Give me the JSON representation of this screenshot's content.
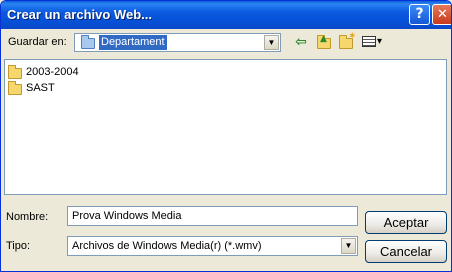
{
  "window": {
    "title": "Crear un archivo Web..."
  },
  "titlebar": {
    "help_glyph": "?",
    "close_glyph": "✕"
  },
  "location": {
    "label": "Guardar en:",
    "value": "Departament",
    "folder_icon": "folder-icon",
    "arrow_glyph": "▼"
  },
  "toolbar": {
    "back_icon": "back-arrow-icon",
    "up_icon": "up-folder-icon",
    "new_folder_icon": "new-folder-icon",
    "views_icon": "views-menu-icon",
    "back_glyph": "⇦",
    "views_glyph": "▾"
  },
  "files": [
    {
      "name": "2003-2004",
      "icon": "folder-icon"
    },
    {
      "name": "SAST",
      "icon": "folder-icon"
    }
  ],
  "filename": {
    "label": "Nombre:",
    "value": "Prova Windows Media"
  },
  "filetype": {
    "label": "Tipo:",
    "value": "Archivos de Windows Media(r) (*.wmv)",
    "arrow_glyph": "▼"
  },
  "buttons": {
    "accept": "Aceptar",
    "cancel": "Cancelar"
  },
  "colors": {
    "titlebar": "#0a5fd8",
    "dialog_bg": "#ece9d8",
    "selection": "#316ac5",
    "close": "#c8391c"
  }
}
